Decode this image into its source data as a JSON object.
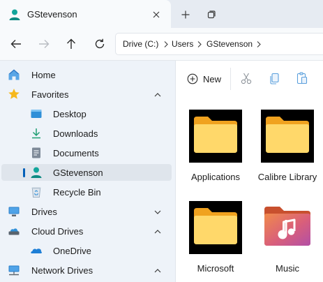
{
  "tab": {
    "title": "GStevenson",
    "close_icon": "close-icon",
    "new_tab_icon": "plus-icon",
    "tab_overview_icon": "tabs-icon"
  },
  "nav": {
    "back_icon": "arrow-left-icon",
    "forward_icon": "arrow-right-icon",
    "up_icon": "arrow-up-icon",
    "refresh_icon": "refresh-icon",
    "breadcrumb": [
      "Drive (C:)",
      "Users",
      "GStevenson"
    ]
  },
  "sidebar": {
    "items": [
      {
        "label": "Home",
        "icon": "home-icon",
        "level": 0
      },
      {
        "label": "Favorites",
        "icon": "star-icon",
        "level": 0,
        "expanded": true
      },
      {
        "label": "Desktop",
        "icon": "desktop-icon",
        "level": 1
      },
      {
        "label": "Downloads",
        "icon": "download-icon",
        "level": 1
      },
      {
        "label": "Documents",
        "icon": "document-icon",
        "level": 1
      },
      {
        "label": "GStevenson",
        "icon": "user-icon",
        "level": 1,
        "selected": true
      },
      {
        "label": "Recycle Bin",
        "icon": "recycle-bin-icon",
        "level": 1
      },
      {
        "label": "Drives",
        "icon": "monitor-icon",
        "level": 0,
        "expanded": false
      },
      {
        "label": "Cloud Drives",
        "icon": "cloud-drive-icon",
        "level": 0,
        "expanded": true
      },
      {
        "label": "OneDrive",
        "icon": "onedrive-icon",
        "level": 1
      },
      {
        "label": "Network Drives",
        "icon": "network-drive-icon",
        "level": 0,
        "expanded": true
      }
    ]
  },
  "toolbar": {
    "new_label": "New",
    "cut_icon": "scissors-icon",
    "copy_icon": "copy-icon",
    "paste_icon": "paste-icon"
  },
  "files": [
    {
      "label": "Applications",
      "icon": "folder-icon"
    },
    {
      "label": "Calibre Library",
      "icon": "folder-icon"
    },
    {
      "label": "Microsoft",
      "icon": "folder-icon"
    },
    {
      "label": "Music",
      "icon": "music-folder-icon"
    }
  ],
  "colors": {
    "accent": "#005fb8",
    "folder_yellow": "#ffd86a",
    "folder_orange": "#f0a21f",
    "user_teal": "#12a59b",
    "star": "#f6b81c",
    "music_folder": "#e06a4f"
  }
}
